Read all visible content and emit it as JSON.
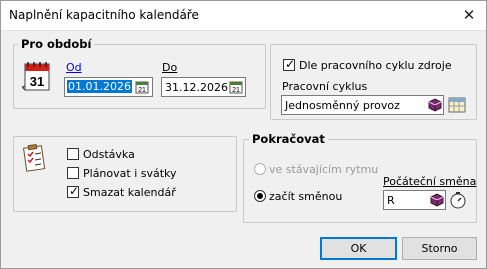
{
  "window": {
    "title": "Naplnění kapacitního kalendáře",
    "close_glyph": "✕"
  },
  "period": {
    "legend": "Pro období",
    "calendar_badge_text": "31",
    "from_label": "Od",
    "from_value": "01.01.2026",
    "to_label": "Do",
    "to_value": "31.12.2026"
  },
  "cycle": {
    "use_resource_cycle_label": "Dle pracovního cyklu zdroje",
    "use_resource_cycle_checked": true,
    "work_cycle_label": "Pracovní cyklus",
    "work_cycle_value": "Jednosměnný provoz"
  },
  "options": {
    "shutdown_label": "Odstávka",
    "shutdown_checked": false,
    "plan_holidays_label": "Plánovat i svátky",
    "plan_holidays_checked": false,
    "delete_calendar_label": "Smazat kalendář",
    "delete_calendar_checked": true
  },
  "continue": {
    "legend": "Pokračovat",
    "existing_rhythm_label": "ve stávajícím rytmu",
    "start_shift_label": "začít směnou",
    "selected": "start_shift",
    "initial_shift_label": "Počáteční směna",
    "initial_shift_value": "R"
  },
  "buttons": {
    "ok": "OK",
    "cancel": "Storno"
  },
  "colors": {
    "selection": "#0078d7",
    "book_icon": "#7a2a6e",
    "calendar_red": "#d0211a"
  }
}
